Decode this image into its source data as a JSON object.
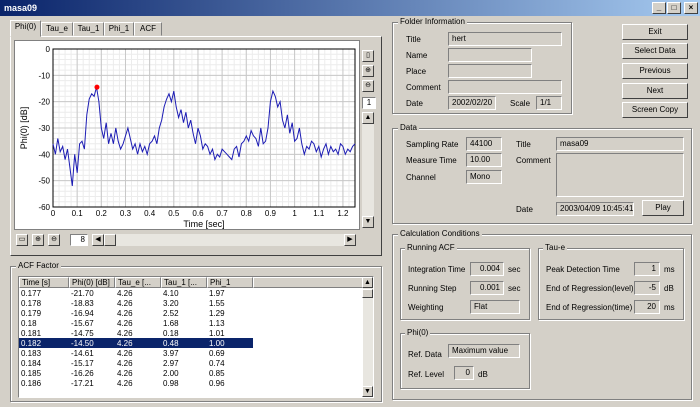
{
  "window": {
    "title": "masa09"
  },
  "tabs": [
    "Phi(0)",
    "Tau_e",
    "Tau_1",
    "Phi_1",
    "ACF"
  ],
  "plot": {
    "page_value": "1",
    "zoom_value": "8"
  },
  "chart_data": {
    "type": "line",
    "xlabel": "Time [sec]",
    "ylabel": "Phi(0) [dB]",
    "xlim": [
      0,
      1.25
    ],
    "ylim": [
      -60,
      0
    ],
    "xticks": [
      "0",
      "0.1",
      "0.2",
      "0.3",
      "0.4",
      "0.5",
      "0.6",
      "0.7",
      "0.8",
      "0.9",
      "1",
      "1.1",
      "1.2"
    ],
    "yticks": [
      "0",
      "-10",
      "-20",
      "-30",
      "-40",
      "-50",
      "-60"
    ],
    "line_color": "#1c1cb4",
    "marker": {
      "x": 0.182,
      "y": -14.5,
      "color": "#ff0000"
    },
    "series": [
      {
        "x": [
          0,
          0.01,
          0.02,
          0.03,
          0.04,
          0.05,
          0.06,
          0.07,
          0.08,
          0.09,
          0.1,
          0.11,
          0.12,
          0.13,
          0.14,
          0.15,
          0.16,
          0.17,
          0.18,
          0.19,
          0.2,
          0.21,
          0.22,
          0.23,
          0.24,
          0.25,
          0.26,
          0.27,
          0.28,
          0.29,
          0.3,
          0.31,
          0.32,
          0.33,
          0.34,
          0.35,
          0.36,
          0.37,
          0.38,
          0.39,
          0.4,
          0.41,
          0.42,
          0.43,
          0.44,
          0.45,
          0.46,
          0.47,
          0.48,
          0.49,
          0.5,
          0.51,
          0.52,
          0.53,
          0.54,
          0.55,
          0.56,
          0.57,
          0.58,
          0.59,
          0.6,
          0.61,
          0.62,
          0.63,
          0.64,
          0.65,
          0.66,
          0.67,
          0.68,
          0.69,
          0.7,
          0.71,
          0.72,
          0.73,
          0.74,
          0.75,
          0.76,
          0.77,
          0.78,
          0.79,
          0.8,
          0.81,
          0.82,
          0.83,
          0.84,
          0.85,
          0.86,
          0.87,
          0.88,
          0.89,
          0.9,
          0.91,
          0.92,
          0.93,
          0.94,
          0.95,
          0.96,
          0.97,
          0.98,
          0.99,
          1.0,
          1.01,
          1.02,
          1.03,
          1.04,
          1.05,
          1.06,
          1.07,
          1.08,
          1.09,
          1.1,
          1.11,
          1.12,
          1.13,
          1.14,
          1.15,
          1.16,
          1.17,
          1.18,
          1.19,
          1.2,
          1.21,
          1.22,
          1.23,
          1.24,
          1.25
        ],
        "y": [
          -36,
          -40,
          -34,
          -39,
          -37,
          -42,
          -38,
          -45,
          -52,
          -40,
          -47,
          -36,
          -35,
          -38,
          -25,
          -19,
          -17,
          -18,
          -14.5,
          -20,
          -30,
          -34,
          -28,
          -36,
          -32,
          -36,
          -30,
          -35,
          -38,
          -36,
          -33,
          -30,
          -34,
          -38,
          -36,
          -40,
          -36,
          -39,
          -37,
          -40,
          -36,
          -35,
          -33,
          -36,
          -30,
          -27,
          -22,
          -19,
          -17,
          -20,
          -16,
          -22,
          -26,
          -23,
          -28,
          -24,
          -30,
          -27,
          -32,
          -36,
          -30,
          -33,
          -38,
          -36,
          -37,
          -40,
          -38,
          -42,
          -40,
          -41,
          -38,
          -39,
          -40,
          -41,
          -42,
          -38,
          -37,
          -41,
          -36,
          -35,
          -33,
          -35,
          -31,
          -33,
          -34,
          -37,
          -30,
          -36,
          -35,
          -30,
          -20,
          -16,
          -18,
          -22,
          -20,
          -27,
          -30,
          -25,
          -32,
          -28,
          -35,
          -34,
          -30,
          -36,
          -40,
          -37,
          -38,
          -35,
          -36,
          -39,
          -37,
          -41,
          -38,
          -36,
          -40,
          -37,
          -39,
          -38,
          -40,
          -36,
          -37,
          -40,
          -38,
          -39,
          -37,
          -36
        ]
      }
    ]
  },
  "folder": {
    "group_label": "Folder Information",
    "title_label": "Title",
    "title_value": "hert",
    "name_label": "Name",
    "name_value": "",
    "place_label": "Place",
    "place_value": "",
    "comment_label": "Comment",
    "comment_value": "",
    "date_label": "Date",
    "date_value": "2002/02/20",
    "scale_label": "Scale",
    "scale_value": "1/1"
  },
  "buttons": {
    "exit": "Exit",
    "select_data": "Select Data",
    "previous": "Previous",
    "next": "Next",
    "screen_copy": "Screen Copy",
    "play": "Play"
  },
  "data_box": {
    "group_label": "Data",
    "sampling_rate_label": "Sampling Rate",
    "sampling_rate_value": "44100",
    "measure_time_label": "Measure Time",
    "measure_time_value": "10.00",
    "channel_label": "Channel",
    "channel_value": "Mono",
    "title_label": "Title",
    "title_value": "masa09",
    "comment_label": "Comment",
    "comment_value": "",
    "date_label": "Date",
    "date_value": "2003/04/09 10:45:41"
  },
  "calc": {
    "group_label": "Calculation Conditions",
    "running_acf": {
      "group_label": "Running ACF",
      "integration_time_label": "Integration Time",
      "integration_time_value": "0.004",
      "integration_time_unit": "sec",
      "running_step_label": "Running Step",
      "running_step_value": "0.001",
      "running_step_unit": "sec",
      "weighting_label": "Weighting",
      "weighting_value": "Flat"
    },
    "tau_e": {
      "group_label": "Tau-e",
      "peak_label": "Peak Detection Time",
      "peak_value": "1",
      "peak_unit": "ms",
      "end_level_label": "End of Regression(level)",
      "end_level_value": "-5",
      "end_level_unit": "dB",
      "end_time_label": "End of Regression(time)",
      "end_time_value": "20",
      "end_time_unit": "ms"
    },
    "phi0": {
      "group_label": "Phi(0)",
      "ref_data_label": "Ref. Data",
      "ref_data_value": "Maximum value",
      "ref_level_label": "Ref. Level",
      "ref_level_value": "0",
      "ref_level_unit": "dB"
    }
  },
  "acf_factor": {
    "group_label": "ACF Factor",
    "columns": [
      "Time [s]",
      "Phi(0) [dB]",
      "Tau_e [...",
      "Tau_1 [...",
      "Phi_1"
    ],
    "rows": [
      [
        "0.177",
        "-21.70",
        "4.26",
        "4.10",
        "1.97"
      ],
      [
        "0.178",
        "-18.83",
        "4.26",
        "3.20",
        "1.55"
      ],
      [
        "0.179",
        "-16.94",
        "4.26",
        "2.52",
        "1.29"
      ],
      [
        "0.18",
        "-15.67",
        "4.26",
        "1.68",
        "1.13"
      ],
      [
        "0.181",
        "-14.75",
        "4.26",
        "0.18",
        "1.01"
      ],
      [
        "0.182",
        "-14.50",
        "4.26",
        "0.48",
        "1.00"
      ],
      [
        "0.183",
        "-14.61",
        "4.26",
        "3.97",
        "0.69"
      ],
      [
        "0.184",
        "-15.17",
        "4.26",
        "2.97",
        "0.74"
      ],
      [
        "0.185",
        "-16.26",
        "4.26",
        "2.00",
        "0.85"
      ],
      [
        "0.186",
        "-17.21",
        "4.26",
        "0.98",
        "0.96"
      ]
    ],
    "selected_index": 5
  }
}
